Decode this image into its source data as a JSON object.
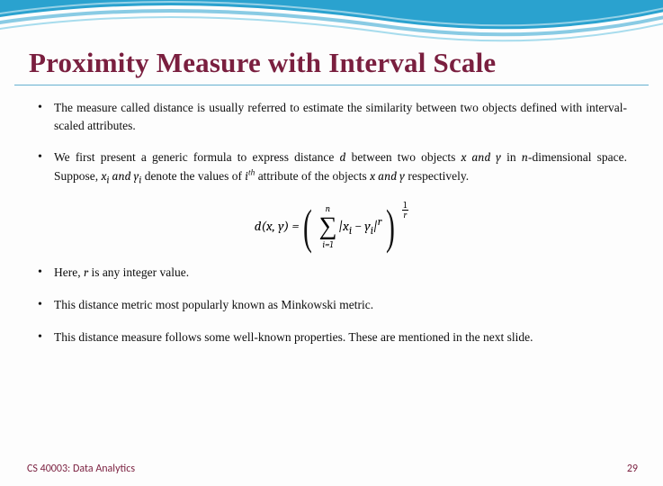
{
  "title": "Proximity Measure with Interval Scale",
  "bullets": {
    "b1a": "The measure called ",
    "b1_term": "distance",
    "b1b": " is usually referred to estimate the similarity between two objects defined with ",
    "b1_term2": "interval-scaled",
    "b1c": " attributes.",
    "b2a": "We first present a generic formula to express distance ",
    "b2_d": "d",
    "b2b": "  between two objects ",
    "b2_xy": "x and y",
    "b2c": " in ",
    "b2_n": "n",
    "b2d": "-dimensional space. Suppose, ",
    "b2_xiyi": "x",
    "b2_sub_i1": "i",
    "b2_and": " and ",
    "b2_yi": "y",
    "b2_sub_i2": "i",
    "b2e": " denote the values of ",
    "b2_ith": "i",
    "b2_th": "th",
    "b2f": " attribute of the objects ",
    "b2_xy2": "x and y",
    "b2g": " respectively.",
    "b3a": "Here, ",
    "b3_r": "r",
    "b3b": " is any integer value.",
    "b4a": "This distance metric most popularly known as ",
    "b4_term": "Minkowski metric",
    "b4b": ".",
    "b5": "This distance measure follows some well-known properties. These are mentioned in the next slide."
  },
  "formula": {
    "lhs": "d(x, y) = ",
    "sigma_top": "n",
    "sigma_bot": "i=1",
    "body_a": "|x",
    "body_sub1": "i",
    "body_b": " − y",
    "body_sub2": "i",
    "body_c": "|",
    "body_exp": "r",
    "outer_num": "1",
    "outer_den": "r"
  },
  "footer": {
    "left": "CS 40003: Data Analytics",
    "right": "29"
  }
}
